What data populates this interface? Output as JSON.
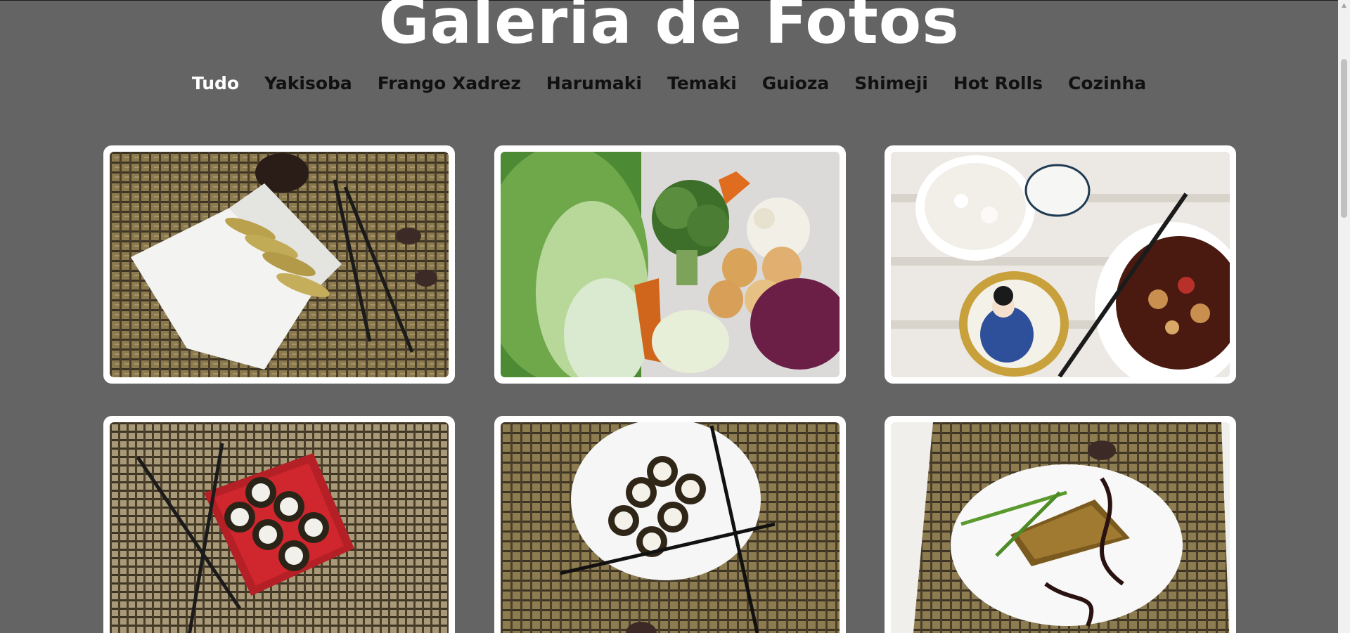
{
  "header": {
    "title": "Galeria de Fotos"
  },
  "nav": {
    "items": [
      {
        "label": "Tudo",
        "active": true
      },
      {
        "label": "Yakisoba",
        "active": false
      },
      {
        "label": "Frango Xadrez",
        "active": false
      },
      {
        "label": "Harumaki",
        "active": false
      },
      {
        "label": "Temaki",
        "active": false
      },
      {
        "label": "Guioza",
        "active": false
      },
      {
        "label": "Shimeji",
        "active": false
      },
      {
        "label": "Hot Rolls",
        "active": false
      },
      {
        "label": "Cozinha",
        "active": false
      }
    ]
  },
  "colors": {
    "background": "#646464",
    "title": "#ffffff",
    "nav_active": "#ffffff",
    "nav_inactive": "#111111",
    "card_frame": "#ffffff"
  }
}
